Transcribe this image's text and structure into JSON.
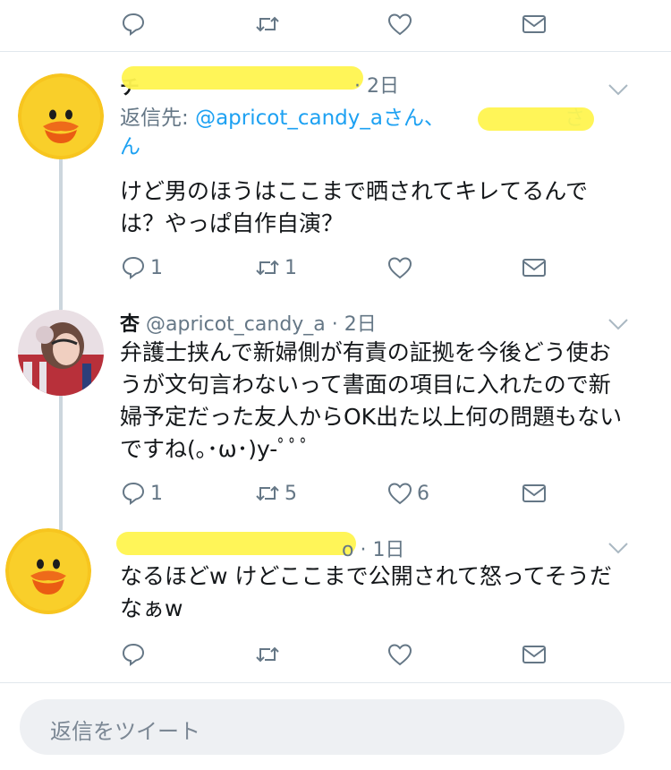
{
  "top_actions": {
    "reply_count": "",
    "retweet_count": "",
    "like_count": ""
  },
  "tweets": [
    {
      "name": "チ",
      "handle": "",
      "time": "· 2日",
      "reply_to_label": "返信先: ",
      "reply_to_handle": "@apricot_candy_a",
      "reply_to_suffix": "さん、",
      "reply_to_tail": "さ",
      "reply_to_tail2": "ん",
      "text": "けど男のほうはここまで晒されてキレてるんでは？やっぱ自作自演？",
      "reply_count": "1",
      "retweet_count": "1",
      "like_count": ""
    },
    {
      "name": "杏",
      "handle": "@apricot_candy_a",
      "time": "· 2日",
      "text": "弁護士挟んで新婦側が有責の証拠を今後どう使おうが文句言わないって書面の項目に入れたので新婦予定だった友人からOK出た以上何の問題もないですね(｡･ω･)y-ﾟﾟﾟ",
      "reply_count": "1",
      "retweet_count": "5",
      "like_count": "6"
    },
    {
      "name": "",
      "handle": "",
      "time": "o · 1日",
      "text": "なるほどw けどここまで公開されて怒ってそうだなぁw",
      "reply_count": "",
      "retweet_count": "",
      "like_count": ""
    }
  ],
  "reply_box": {
    "placeholder": "返信をツイート"
  },
  "colors": {
    "link": "#1da1f2",
    "muted": "#657786",
    "redaction": "#fff44f"
  },
  "icons": [
    "reply-icon",
    "retweet-icon",
    "like-icon",
    "message-icon",
    "chevron-down-icon",
    "avatar"
  ]
}
